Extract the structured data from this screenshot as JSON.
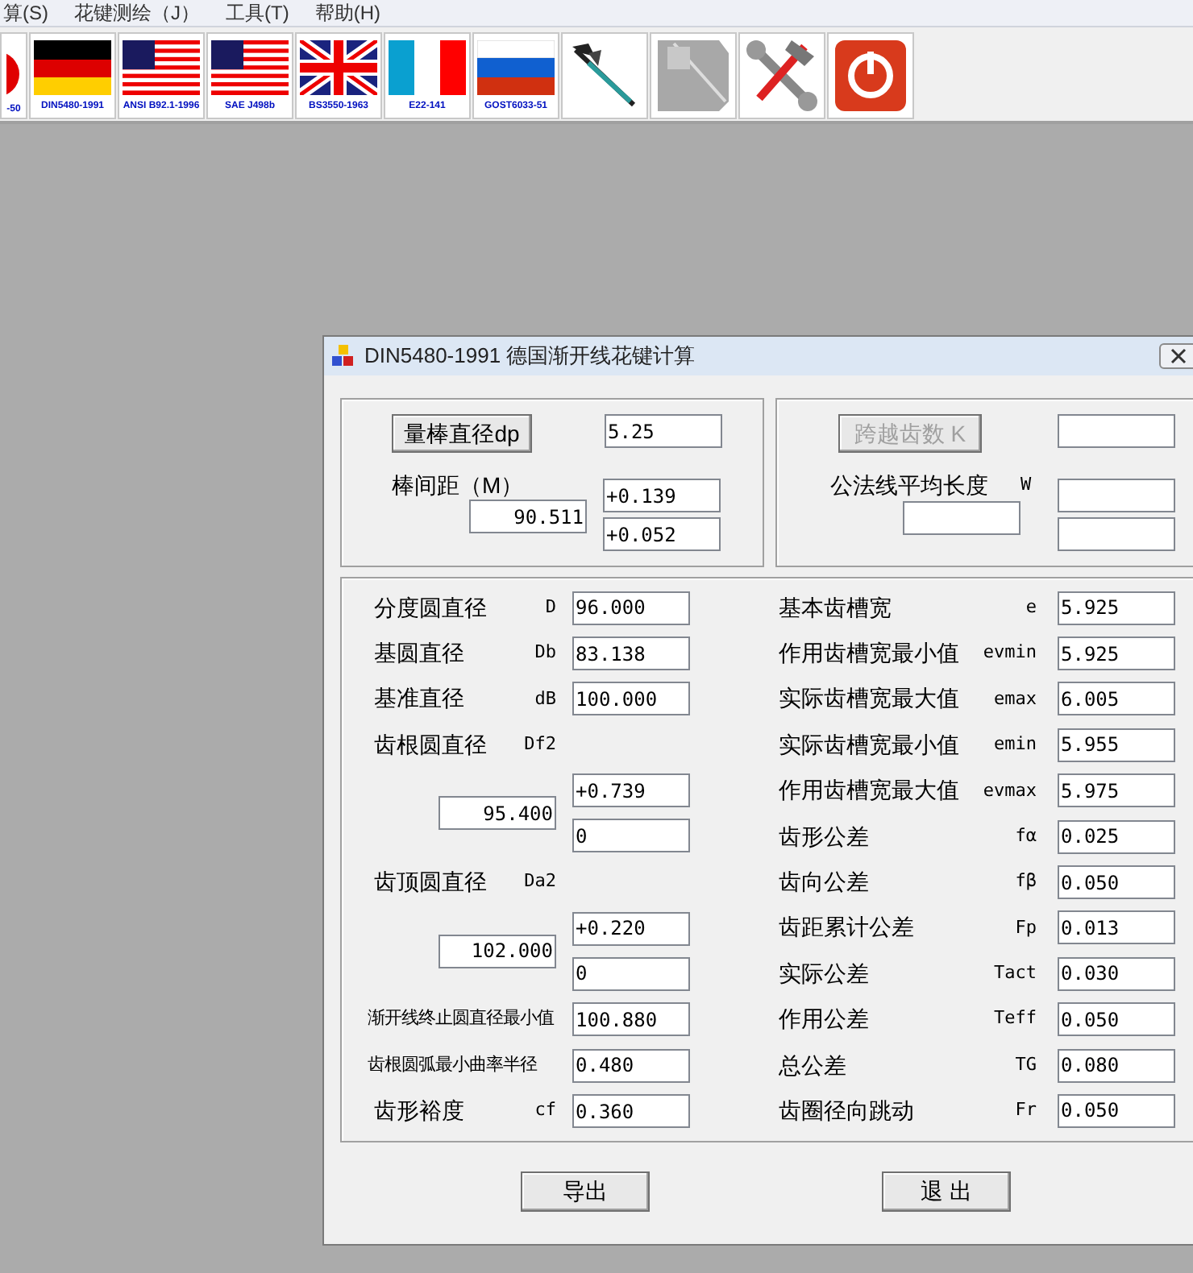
{
  "menu": [
    {
      "label": "算(S)"
    },
    {
      "label": "花键测绘（J）"
    },
    {
      "label": "工具(T)"
    },
    {
      "label": "帮助(H)"
    }
  ],
  "toolbar": [
    {
      "kind": "cut",
      "label": "-50"
    },
    {
      "kind": "flag_de",
      "label": "DIN5480-1991"
    },
    {
      "kind": "flag_us",
      "label": "ANSI B92.1-1996"
    },
    {
      "kind": "flag_us",
      "label": "SAE J498b"
    },
    {
      "kind": "flag_uk",
      "label": "BS3550-1963"
    },
    {
      "kind": "flag_fr",
      "label": "E22-141"
    },
    {
      "kind": "flag_ru",
      "label": "GOST6033-51"
    },
    {
      "kind": "caliper"
    },
    {
      "kind": "grid_disabled"
    },
    {
      "kind": "tools"
    },
    {
      "kind": "power"
    }
  ],
  "dialog": {
    "title": "DIN5480-1991 德国渐开线花键计算",
    "pin_group": {
      "button": "量棒直径dp",
      "dp_value": "5.25",
      "distance_label": "棒间距（M）",
      "distance_value": "90.511",
      "upper": "+0.139",
      "lower": "+0.052"
    },
    "span_group": {
      "button": {
        "label": "跨越齿数 K",
        "disabled": true
      },
      "label": "公法线平均长度",
      "symbol": "W"
    },
    "left_rows": [
      {
        "kind": "field",
        "label": "分度圆直径",
        "symbol": "D",
        "value": "96.000"
      },
      {
        "kind": "field",
        "label": "基圆直径",
        "symbol": "Db",
        "value": "83.138"
      },
      {
        "kind": "field",
        "label": "基准直径",
        "symbol": "dB",
        "value": "100.000"
      },
      {
        "kind": "heading",
        "label": "齿根圆直径",
        "symbol": "Df2"
      },
      {
        "kind": "tolerance",
        "value": "95.400",
        "upper": "+0.739",
        "lower": "0"
      },
      {
        "kind": "heading",
        "label": "齿顶圆直径",
        "symbol": "Da2"
      },
      {
        "kind": "tolerance",
        "value": "102.000",
        "upper": "+0.220",
        "lower": "0"
      },
      {
        "kind": "long",
        "label": "渐开线终止圆直径最小值",
        "value": "100.880"
      },
      {
        "kind": "long",
        "label": "齿根圆弧最小曲率半径",
        "value": "0.480"
      },
      {
        "kind": "field",
        "label": "齿形裕度",
        "symbol": "cf",
        "value": "0.360"
      }
    ],
    "right_rows": [
      {
        "label": "基本齿槽宽",
        "symbol": "e",
        "value": "5.925"
      },
      {
        "label": "作用齿槽宽最小值",
        "symbol": "evmin",
        "value": "5.925"
      },
      {
        "label": "实际齿槽宽最大值",
        "symbol": "emax",
        "value": "6.005"
      },
      {
        "label": "实际齿槽宽最小值",
        "symbol": "emin",
        "value": "5.955"
      },
      {
        "label": "作用齿槽宽最大值",
        "symbol": "evmax",
        "value": "5.975"
      },
      {
        "label": "齿形公差",
        "symbol": "fα",
        "value": "0.025"
      },
      {
        "label": "齿向公差",
        "symbol": "fβ",
        "value": "0.050"
      },
      {
        "label": "齿距累计公差",
        "symbol": "Fp",
        "value": "0.013"
      },
      {
        "label": "实际公差",
        "symbol": "Tact",
        "value": "0.030"
      },
      {
        "label": "作用公差",
        "symbol": "Teff",
        "value": "0.050"
      },
      {
        "label": "总公差",
        "symbol": "TG",
        "value": "0.080"
      },
      {
        "label": "齿圈径向跳动",
        "symbol": "Fr",
        "value": "0.050"
      }
    ],
    "buttons": [
      "导出",
      "退 出"
    ]
  }
}
